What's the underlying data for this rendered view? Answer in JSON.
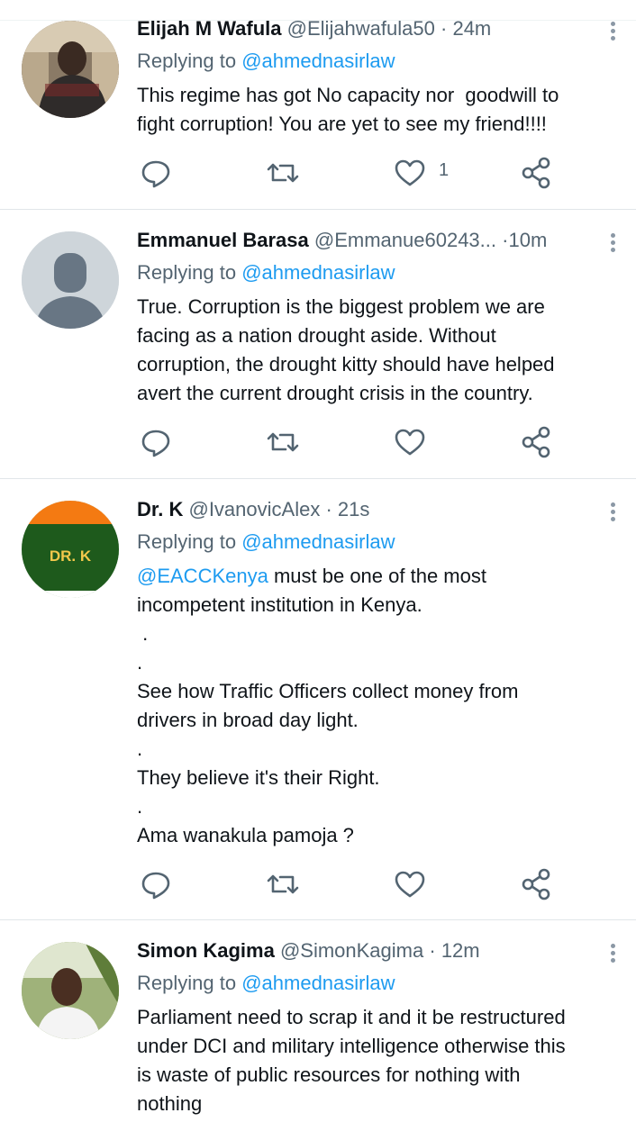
{
  "tweets": [
    {
      "name": "Elijah M Wafula",
      "handle": "@Elijahwafula50",
      "sep": "·",
      "time": "24m",
      "reply_prefix": "Replying to",
      "reply_to": "@ahmednasirlaw",
      "lines": [
        "This regime has got No capacity nor  goodwill to",
        "fight corruption! You are yet to see my friend!!!!"
      ],
      "like_count": "1",
      "avatar": "photo"
    },
    {
      "name": "Emmanuel Barasa",
      "handle": "@Emmanue60243...",
      "sep": "·",
      "time": "10m",
      "reply_prefix": "Replying to",
      "reply_to": "@ahmednasirlaw",
      "lines": [
        "True. Corruption is the biggest problem we are",
        "facing as a nation drought aside. Without",
        "corruption, the drought kitty should have helped",
        "avert the current drought crisis in the country."
      ],
      "like_count": "",
      "avatar": "default-profile"
    },
    {
      "name": "Dr. K",
      "handle": "@IvanovicAlex",
      "sep": "·",
      "time": "21s",
      "reply_prefix": "Replying to",
      "reply_to": "@ahmednasirlaw",
      "mention": "@EACCKenya",
      "first_line_rest": " must be one of the most",
      "lines": [
        "incompetent institution in Kenya.",
        " .",
        ".",
        "See how Traffic Officers collect money from",
        "drivers in broad day light.",
        ".",
        "They believe it's their Right.",
        ".",
        "Ama wanakula pamoja ?"
      ],
      "like_count": "",
      "avatar_text": "DR. K"
    },
    {
      "name": "Simon Kagima",
      "handle": "@SimonKagima",
      "sep": "·",
      "time": "12m",
      "reply_prefix": "Replying to",
      "reply_to": "@ahmednasirlaw",
      "lines": [
        "Parliament need to scrap it and it be restructured",
        "under DCI and military intelligence otherwise this",
        "is waste of public resources for nothing with",
        "nothing"
      ],
      "like_count": "",
      "avatar": "photo"
    }
  ],
  "icons": {
    "reply": "reply-icon",
    "retweet": "retweet-icon",
    "like": "like-icon",
    "share": "share-icon",
    "more": "more-icon"
  },
  "colors": {
    "text": "#0f1419",
    "secondary": "#536471",
    "link": "#1d9bf0",
    "icon": "#536471",
    "divider": "#e1e6e9"
  }
}
